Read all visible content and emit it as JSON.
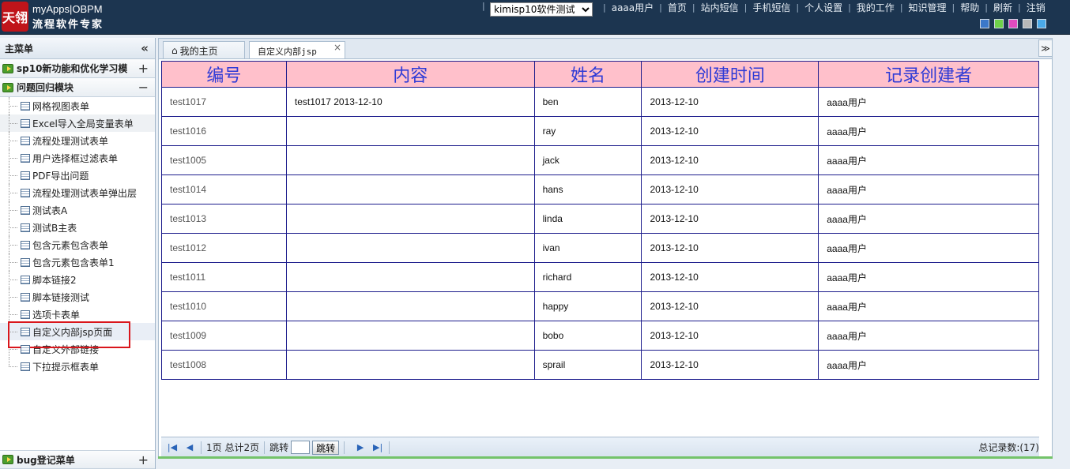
{
  "header": {
    "logo_mark": "天翎",
    "logo_title": "myApps|OBPM",
    "logo_sub": "流程软件专家",
    "system_select": "kimisp10软件测试",
    "nav": [
      "aaaa用户",
      "首页",
      "站内短信",
      "手机短信",
      "个人设置",
      "我的工作",
      "知识管理",
      "帮助",
      "刷新",
      "注销"
    ],
    "theme_colors": [
      "#3b78c9",
      "#6fd04a",
      "#e04bbf",
      "#b8b8b8",
      "#4aa9e8"
    ]
  },
  "sidebar": {
    "title": "主菜单",
    "collapse_icon": "«",
    "groups": [
      {
        "label": "sp10新功能和优化学习模",
        "toggle": "+"
      },
      {
        "label": "问题回归模块",
        "toggle": "−"
      }
    ],
    "items": [
      "网格视图表单",
      "Excel导入全局变量表单",
      "流程处理测试表单",
      "用户选择框过滤表单",
      "PDF导出问题",
      "流程处理测试表单弹出层",
      "测试表A",
      "测试B主表",
      "包含元素包含表单",
      "包含元素包含表单1",
      "脚本链接2",
      "脚本链接测试",
      "选项卡表单",
      "自定义内部jsp页面",
      "自定义外部链接",
      "下拉提示框表单"
    ],
    "bottom_group": {
      "label": "bug登记菜单",
      "toggle": "+"
    }
  },
  "tabs": {
    "home": "我的主页",
    "active": "自定义内部jsp",
    "close": "×",
    "menu": "≫"
  },
  "table": {
    "headers": [
      "编号",
      "内容",
      "姓名",
      "创建时间",
      "记录创建者"
    ],
    "rows": [
      [
        "test1017",
        "test1017 2013-12-10",
        "ben",
        "2013-12-10",
        "aaaa用户"
      ],
      [
        "test1016",
        "",
        "ray",
        "2013-12-10",
        "aaaa用户"
      ],
      [
        "test1005",
        "",
        "jack",
        "2013-12-10",
        "aaaa用户"
      ],
      [
        "test1014",
        "",
        "hans",
        "2013-12-10",
        "aaaa用户"
      ],
      [
        "test1013",
        "",
        "linda",
        "2013-12-10",
        "aaaa用户"
      ],
      [
        "test1012",
        "",
        "ivan",
        "2013-12-10",
        "aaaa用户"
      ],
      [
        "test1011",
        "",
        "richard",
        "2013-12-10",
        "aaaa用户"
      ],
      [
        "test1010",
        "",
        "happy",
        "2013-12-10",
        "aaaa用户"
      ],
      [
        "test1009",
        "",
        "bobo",
        "2013-12-10",
        "aaaa用户"
      ],
      [
        "test1008",
        "",
        "sprail",
        "2013-12-10",
        "aaaa用户"
      ]
    ]
  },
  "pager": {
    "page_info": "1页 总计2页",
    "jump_label": "跳转",
    "jump_value": "",
    "go_label": "跳转",
    "total": "总记录数:(17)"
  }
}
